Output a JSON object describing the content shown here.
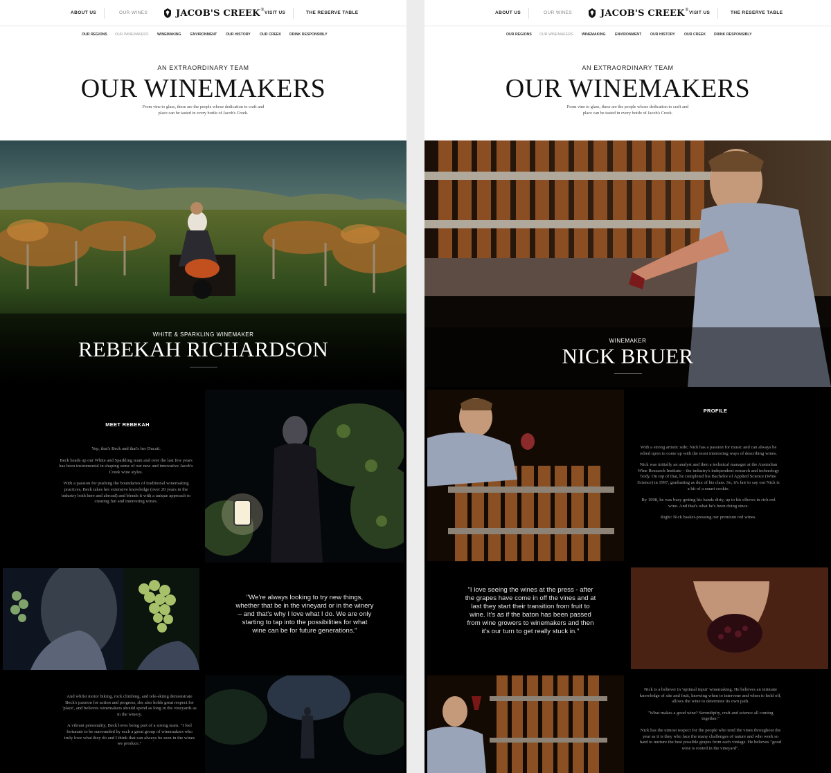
{
  "nav": {
    "about": "ABOUT US",
    "wines": "OUR WINES",
    "brand": "JACOB'S CREEK",
    "registered": "®",
    "visit": "VISIT US",
    "reserve": "THE RESERVE TABLE"
  },
  "subnav": [
    "OUR REGIONS",
    "OUR WINEMAKERS",
    "WINEMAKING",
    "ENVIRONMENT",
    "OUR HISTORY",
    "OUR CREEK",
    "DRINK RESPONSIBLY"
  ],
  "page": {
    "eyebrow": "AN EXTRAORDINARY TEAM",
    "title": "OUR WINEMAKERS",
    "intro_line1": "From vine to glass, these are the people whose dedication to craft and",
    "intro_line2": "place can be tasted in every bottle of Jacob's Creek."
  },
  "left": {
    "role": "WHITE & SPARKLING WINEMAKER",
    "name": "REBEKAH RICHARDSON",
    "section_title": "MEET REBEKAH",
    "bio": [
      "Yep, that's Beck and that's her Ducati.",
      "Beck heads up our White and Sparkling team and over the last few years has been instrumental in shaping some of our new and innovative Jacob's Creek wine styles.",
      "With a passion for pushing the boundaries of traditional winemaking practices, Beck takes her extensive knowledge (over 20 years in the industry both here and abroad) and blends it with a unique approach to creating fun and interesting wines."
    ],
    "quote": "\"We're always looking to try new things, whether that be in the vineyard or in the winery – and that's why I love what I do. We are only starting to tap into the possibilities for what wine can be for future generations.\"",
    "bio2": [
      "And whilst motor biking, rock climbing, and tele-skiing demonstrate Beck's passion for action and progress, she also holds great respect for 'place', and believes winemakers should spend as long in the vineyards as in the winery.",
      "A vibrant personality, Beck loves being part of a strong team. \"I feel fortunate to be surrounded by such a great group of winemakers who truly love what they do and I think that can always be seen in the wines we produce.\""
    ]
  },
  "right": {
    "role": "WINEMAKER",
    "name": "NICK BRUER",
    "section_title": "PROFILE",
    "bio": [
      "With a strong artistic side; Nick has a passion for music and can always be relied upon to come up with the most interesting ways of describing wines.",
      "Nick was initially an analyst and then a technical manager at the Australian Wine Research Institute – the industry's independent research and technology body. On top of that, he completed his Bachelor of Applied Science (Wine Science) in 1997, graduating as dux of his class. So, it's fair to say our Nick is a bit of a smart cookie.",
      "By 1998, he was busy getting his hands dirty, up to his elbows in rich red wine. And that's what he's been doing since.",
      "Right: Nick basket-pressing our premium red wines."
    ],
    "quote": "\"I love seeing the wines at the press - after the grapes have come in off the vines and at last they start their transition from fruit to wine. It's as if the baton has been passed from wine growers to winemakers and then it's our turn to get really stuck in.\"",
    "bio2": [
      "Nick is a believer in 'optimal input' winemaking. He believes an intimate knowledge of site and fruit, knowing when to intervene and when to hold off, allows the wine to determine its own path.",
      "\"What makes a good wine? Serendipity, craft and science all coming together.\"",
      "Nick has the utmost respect for the people who tend the vines throughout the year as it is they who face the many challenges of nature and who work so hard to nurture the best possible grapes from each vintage. He believes \"good wine is rooted in the vineyard\"."
    ]
  }
}
